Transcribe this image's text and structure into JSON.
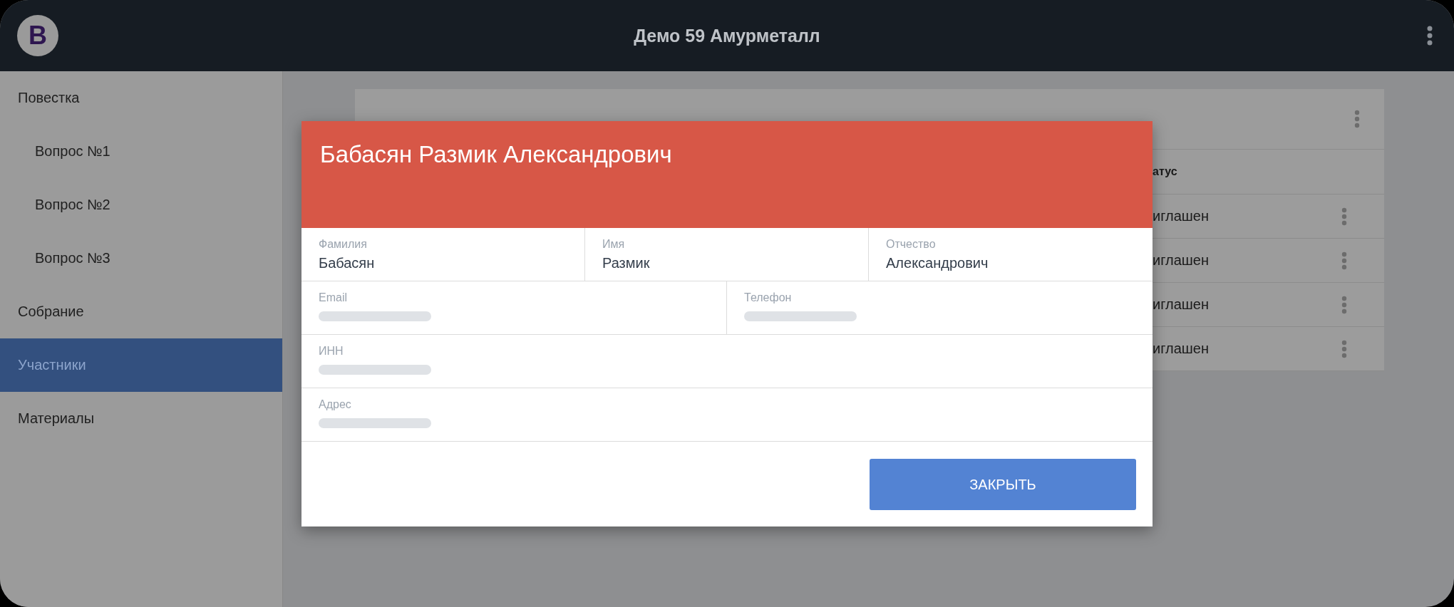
{
  "app": {
    "logo": "B",
    "title": "Демо 59 Амурметалл"
  },
  "sidebar": {
    "items": [
      {
        "label": "Повестка",
        "selected": false,
        "children": [
          {
            "label": "Вопрос №1",
            "selected": false
          },
          {
            "label": "Вопрос №2",
            "selected": false
          },
          {
            "label": "Вопрос №3",
            "selected": false
          }
        ]
      },
      {
        "label": "Собрание",
        "selected": false
      },
      {
        "label": "Участники",
        "selected": true
      },
      {
        "label": "Материалы",
        "selected": false
      }
    ]
  },
  "card": {
    "columns": [
      "атус"
    ],
    "rows": [
      {
        "status": "иглашен"
      },
      {
        "status": "иглашен"
      },
      {
        "status": "иглашен"
      },
      {
        "status": "иглашен"
      }
    ]
  },
  "dialog": {
    "title": "Бабасян Размик Александрович",
    "rows": [
      [
        {
          "label": "Фамилия",
          "value": "Бабасян",
          "hidden": false
        },
        {
          "label": "Имя",
          "value": "Размик",
          "hidden": false
        },
        {
          "label": "Отчество",
          "value": "Александрович",
          "hidden": false
        }
      ],
      [
        {
          "label": "Email",
          "hidden": true
        },
        {
          "label": "Телефон",
          "hidden": true
        }
      ],
      [
        {
          "label": "ИНН",
          "hidden": true
        }
      ],
      [
        {
          "label": "Адрес",
          "hidden": true
        }
      ]
    ],
    "close_button": "ЗАКРЫТЬ"
  }
}
